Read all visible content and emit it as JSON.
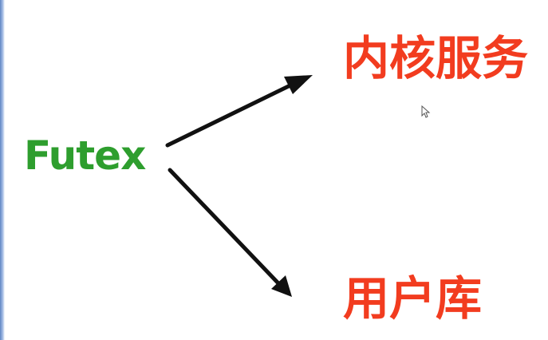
{
  "diagram": {
    "source": {
      "label": "Futex",
      "color": "#2e9e2e"
    },
    "targets": [
      {
        "label": "内核服务",
        "color": "#f23c1f"
      },
      {
        "label": "用户库",
        "color": "#f23c1f"
      }
    ],
    "arrow_color": "#111111"
  }
}
